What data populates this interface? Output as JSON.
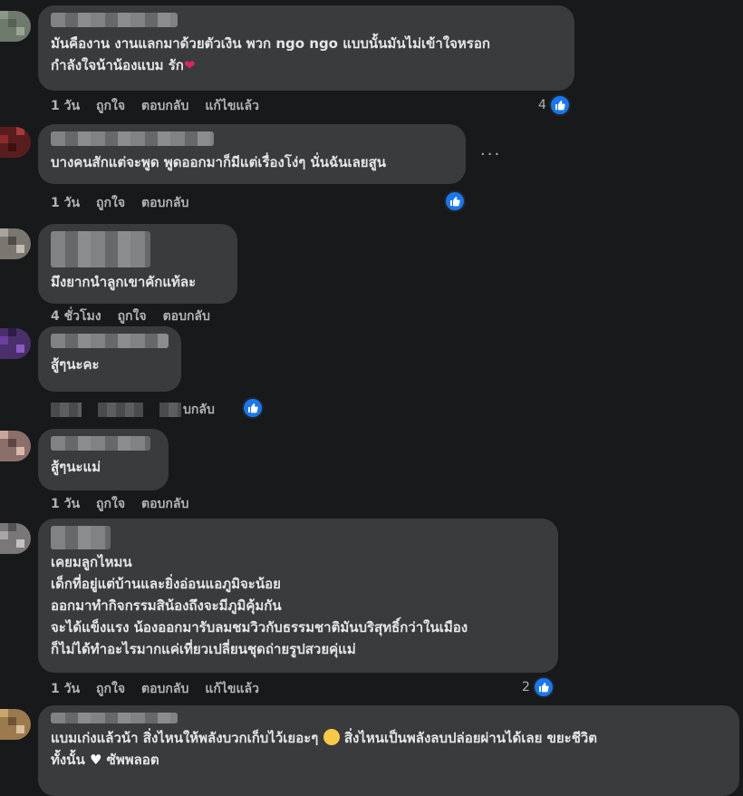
{
  "comments": [
    {
      "lines": [
        "มันคืองาน งานแลกมาด้วยตัวเงิน พวก ngo ngo แบบนั้นมันไม่เข้าใจหรอก",
        "กำลังใจน้าน้องแบม รัก"
      ],
      "actions": [
        "1 วัน",
        "ถูกใจ",
        "ตอบกลับ",
        "แก้ไขแล้ว"
      ],
      "likes": "4"
    },
    {
      "lines": [
        "บางคนสักแต่จะพูด พูดออกมาก็มีแต่เรื่องโง่ๆ นั่นฉันเลยสูน"
      ],
      "actions": [
        "1 วัน",
        "ถูกใจ",
        "ตอบกลับ"
      ],
      "likes": "",
      "more": "···"
    },
    {
      "lines": [
        "มึงยากนำลูกเขาคักแท้ละ"
      ],
      "actions": [
        "4 ชั่วโมง",
        "ถูกใจ",
        "ตอบกลับ"
      ],
      "likes": ""
    },
    {
      "lines": [
        "สู้ๆนะคะ"
      ],
      "actions": [
        "บกลับ"
      ],
      "likes": ""
    },
    {
      "lines": [
        "สู้ๆนะแม่"
      ],
      "actions": [
        "1 วัน",
        "ถูกใจ",
        "ตอบกลับ"
      ],
      "likes": ""
    },
    {
      "lines": [
        "เคยมลูกไหมน",
        "เด็กที่อยู่แต่บ้านและยิ่งอ่อนแอภูมิจะน้อย",
        "ออกมาทำกิจกรรมสิน้องถึงจะมีภูมิคุ้มกัน",
        "จะได้แข็งแรง น้องออกมารับลมชมวิวกับธรรมชาติมันบริสุทธิ์กว่าในเมือง",
        "ก็ไม่ได้ทำอะไรมากแค่เที่ยวเปลี่ยนชุดถ่ายรูปสวยคุ่แม่"
      ],
      "actions": [
        "1 วัน",
        "ถูกใจ",
        "ตอบกลับ",
        "แก้ไขแล้ว"
      ],
      "likes": "2"
    },
    {
      "lines": [
        "แบมเก่งแล้วน้า สิ่งไหนให้พลังบวกเก็บไว้เยอะๆ",
        "สิ่งไหนเป็นพลังลบปล่อยผ่านได้เลย ขยะชีวิต",
        "ทั้งนั้น",
        "ซัพพลอต"
      ]
    }
  ],
  "icons": {
    "like": "thumbs-up-icon",
    "heart": "red-heart-emoji",
    "smile": "smiling-face-emoji",
    "white_heart": "white-heart-emoji"
  },
  "colors": {
    "like_blue": "#1877f2",
    "bubble": "#3a3b3c",
    "background": "#18191a"
  }
}
